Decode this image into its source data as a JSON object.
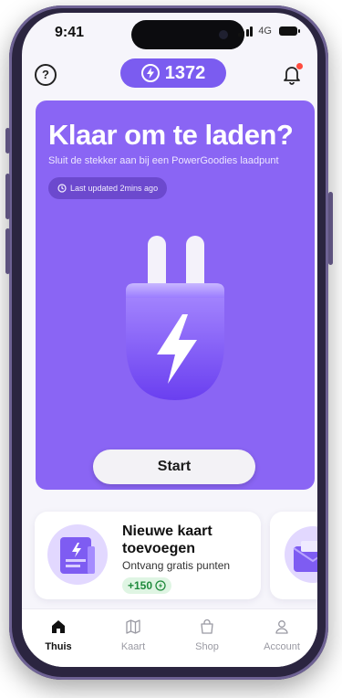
{
  "status_bar": {
    "time": "9:41",
    "network": "4G"
  },
  "header": {
    "help_glyph": "?",
    "points": "1372",
    "bell_icon": "bell-icon"
  },
  "hero": {
    "title": "Klaar om te laden?",
    "subtitle": "Sluit de stekker aan bij een PowerGoodies laadpunt",
    "updated": "Last updated 2mins ago",
    "start_label": "Start"
  },
  "cards": [
    {
      "title": "Nieuwe kaart toevoegen",
      "subtitle": "Ontvang gratis punten",
      "badge": "+150"
    }
  ],
  "tabs": [
    {
      "label": "Thuis",
      "icon": "home-icon",
      "active": true
    },
    {
      "label": "Kaart",
      "icon": "map-icon",
      "active": false
    },
    {
      "label": "Shop",
      "icon": "shopping-bag-icon",
      "active": false
    },
    {
      "label": "Account",
      "icon": "user-icon",
      "active": false
    }
  ],
  "colors": {
    "accent": "#7b5cf0",
    "hero": "#8a65f4",
    "badge_green": "#1f8a3c",
    "notification": "#ff4b3e"
  }
}
